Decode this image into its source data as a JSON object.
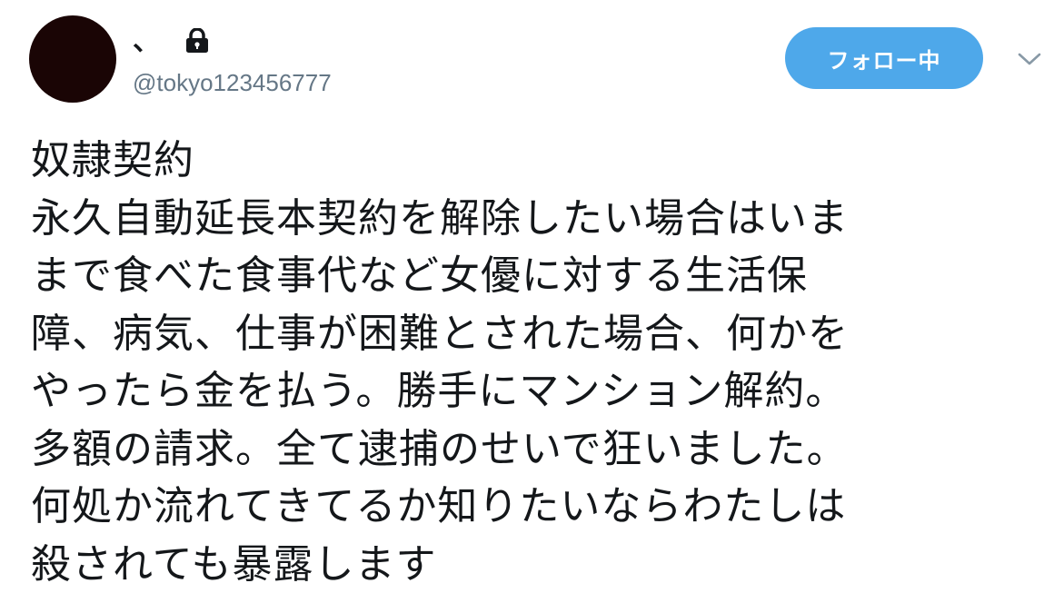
{
  "user": {
    "display_name": "、",
    "handle": "@tokyo123456777",
    "protected_icon": "lock-icon",
    "avatar_color": "#1a0505"
  },
  "actions": {
    "follow_label": "フォロー中",
    "follow_color": "#4ea8ea",
    "more_icon": "chevron-down-icon"
  },
  "tweet": {
    "lines": [
      "奴隷契約",
      "永久自動延長本契約を解除したい場合はいま",
      "まで食べた食事代など女優に対する生活保",
      "障、病気、仕事が困難とされた場合、何かを",
      "やったら金を払う。勝手にマンション解約。",
      "多額の請求。全て逮捕のせいで狂いました。",
      "何処か流れてきてるか知りたいならわたしは",
      "殺されても暴露します"
    ]
  }
}
